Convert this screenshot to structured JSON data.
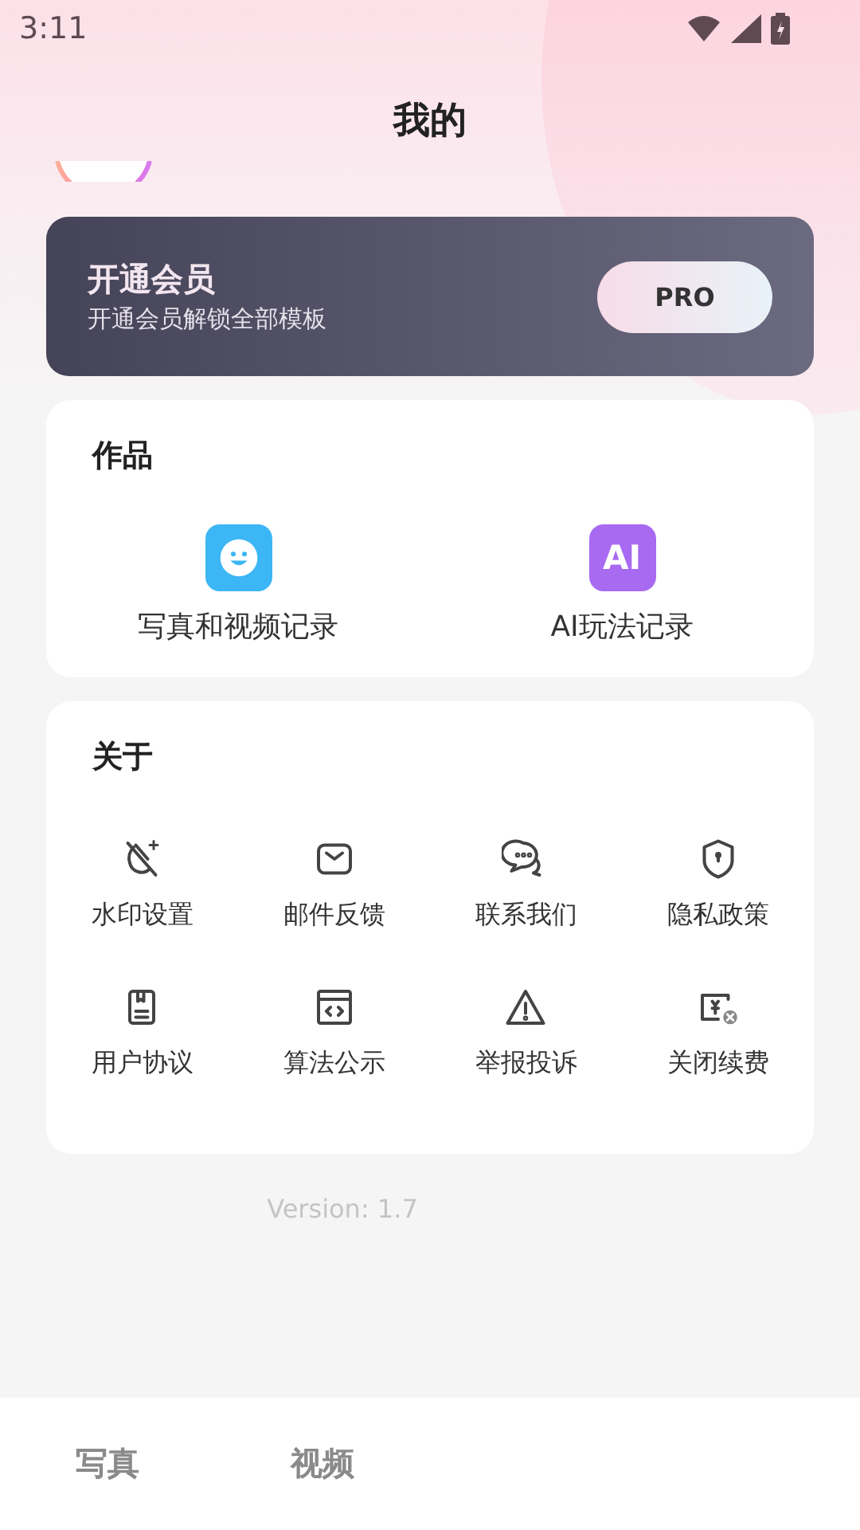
{
  "status_bar": {
    "time": "3:11"
  },
  "header": {
    "title": "我的"
  },
  "vip_card": {
    "title": "开通会员",
    "subtitle": "开通会员解锁全部模板",
    "button": "PRO"
  },
  "works": {
    "title": "作品",
    "items": [
      {
        "label": "写真和视频记录",
        "kind": "face"
      },
      {
        "label": "AI玩法记录",
        "kind": "ai",
        "icon_text": "AI"
      }
    ]
  },
  "about": {
    "title": "关于",
    "items": [
      {
        "label": "水印设置",
        "kind": "watermark"
      },
      {
        "label": "邮件反馈",
        "kind": "mail"
      },
      {
        "label": "联系我们",
        "kind": "chat"
      },
      {
        "label": "隐私政策",
        "kind": "shield"
      },
      {
        "label": "用户协议",
        "kind": "doc"
      },
      {
        "label": "算法公示",
        "kind": "code"
      },
      {
        "label": "举报投诉",
        "kind": "warning"
      },
      {
        "label": "关闭续费",
        "kind": "cancel"
      }
    ]
  },
  "version": "Version: 1.7",
  "bottom_nav": [
    {
      "label": "写真",
      "selected": false
    },
    {
      "label": "视频",
      "selected": false
    }
  ]
}
